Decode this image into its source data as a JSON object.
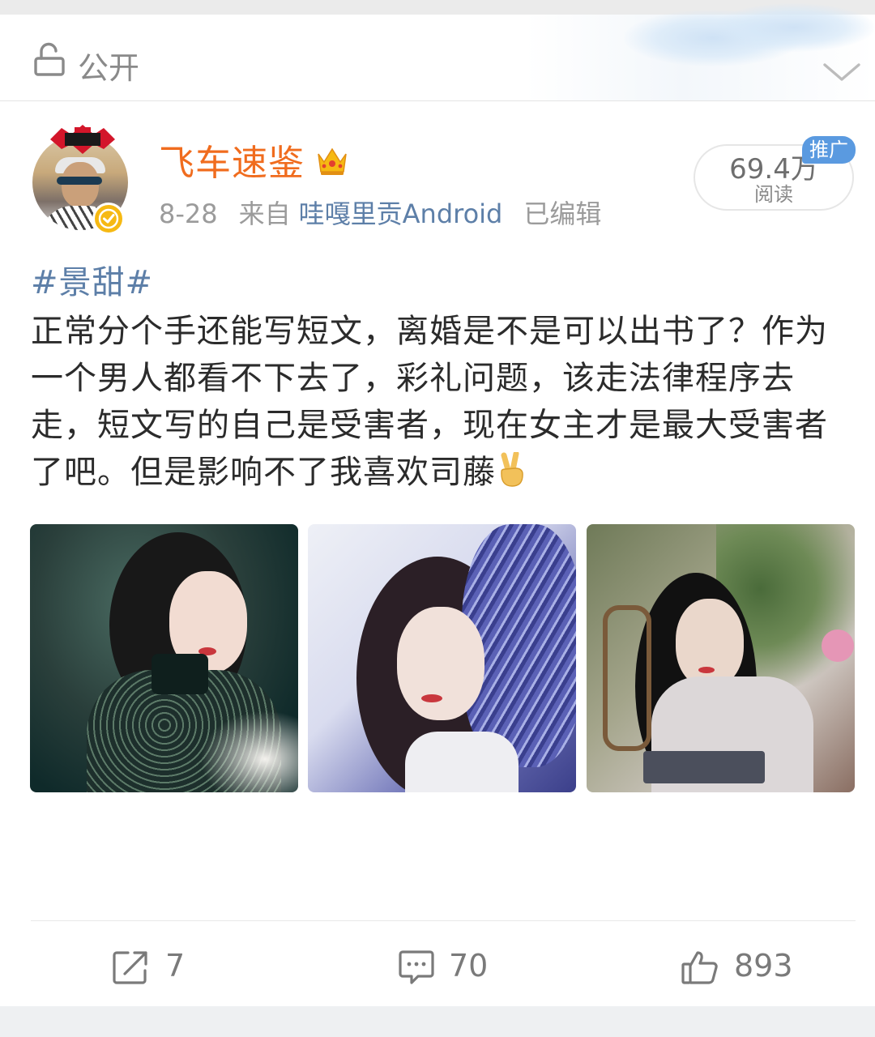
{
  "visibility": {
    "label": "公开",
    "lock_icon": "lock-open-icon",
    "chevron_icon": "chevron-down-icon"
  },
  "post": {
    "author": {
      "name": "飞车速鉴",
      "crown_icon": "crown-icon",
      "verified_icon": "verified-badge-icon"
    },
    "meta": {
      "date": "8-28",
      "source_prefix": "来自",
      "source": "哇嘎里贡Android",
      "edited": "已编辑"
    },
    "reads": {
      "count": "69.4万",
      "label": "阅读",
      "promo_badge": "推广"
    },
    "hashtag": "#景甜#",
    "body": "正常分个手还能写短文，离婚是不是可以出书了？作为一个男人都看不下去了，彩礼问题，该走法律程序去走，短文写的自己是受害者，现在女主才是最大受害者了吧。但是影响不了我喜欢司藤",
    "body_emoji": "victory-hand-emoji",
    "images": [
      "photo-1",
      "photo-2",
      "photo-3"
    ]
  },
  "actions": {
    "repost": {
      "icon": "share-icon",
      "count": "7"
    },
    "comment": {
      "icon": "comment-icon",
      "count": "70"
    },
    "like": {
      "icon": "thumbs-up-icon",
      "count": "893"
    }
  },
  "colors": {
    "username": "#f06c1e",
    "link": "#5d7fa8",
    "verified": "#f6b913",
    "promo": "#5a9ae0"
  }
}
